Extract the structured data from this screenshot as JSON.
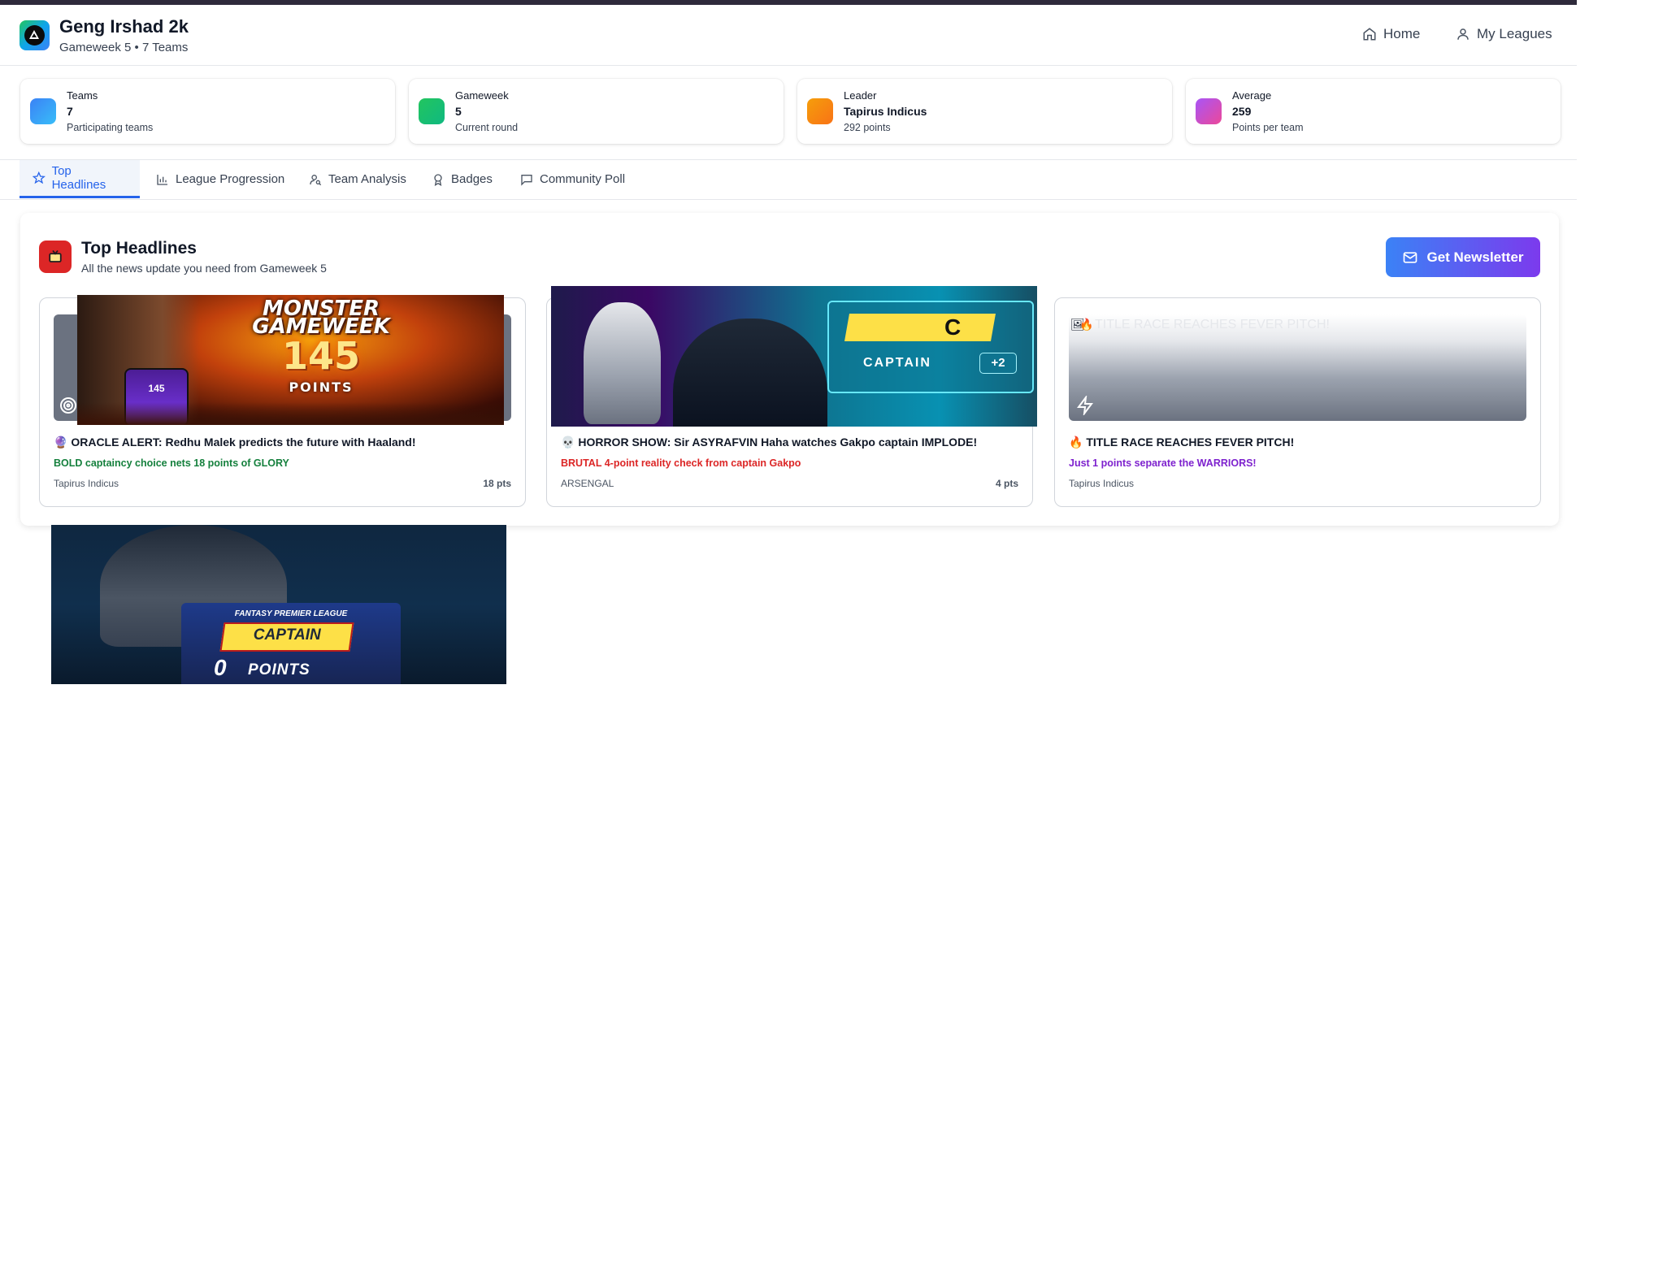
{
  "header": {
    "title": "Geng Irshad 2k",
    "subtitle": "Gameweek 5 • 7 Teams",
    "nav": {
      "home": "Home",
      "my_leagues": "My Leagues"
    }
  },
  "stats": [
    {
      "label": "Teams",
      "value": "7",
      "caption": "Participating teams",
      "color": "#3b82f6"
    },
    {
      "label": "Gameweek",
      "value": "5",
      "caption": "Current round",
      "color": "#22c55e"
    },
    {
      "label": "Leader",
      "value": "Tapirus Indicus",
      "caption": "292 points",
      "color": "#f59e0b"
    },
    {
      "label": "Average",
      "value": "259",
      "caption": "Points per team",
      "color": "#c026d3"
    }
  ],
  "tabs": [
    {
      "label": "Top Headlines",
      "icon": "star-icon",
      "active": true
    },
    {
      "label": "League Progression",
      "icon": "bar-chart-icon"
    },
    {
      "label": "Team Analysis",
      "icon": "user-analysis-icon"
    },
    {
      "label": "Badges",
      "icon": "award-icon"
    },
    {
      "label": "Community Poll",
      "icon": "message-square-icon"
    }
  ],
  "panel": {
    "title": "Top Headlines",
    "subtitle": "All the news update you need from Gameweek 5",
    "newsletter_label": "Get Newsletter"
  },
  "cards": [
    {
      "emoji": "🔮",
      "headline": "ORACLE ALERT: Redhu Malek predicts the future with Haaland!",
      "sub": "BOLD captaincy choice nets 18 points of GLORY",
      "sub_color": "#15803d",
      "author": "Tapirus Indicus",
      "points": "18 pts",
      "image_text_1": "MONSTER",
      "image_text_2": "GAMEWEEK",
      "image_number": "145",
      "image_caption": "POINTS"
    },
    {
      "emoji": "💀",
      "headline": "HORROR SHOW: Sir ASYRAFVIN Haha watches Gakpo captain IMPLODE!",
      "sub": "BRUTAL 4-point reality check from captain Gakpo",
      "sub_color": "#dc2626",
      "author": "ARSENGAL",
      "points": "4 pts",
      "image_badge": "C",
      "image_label": "CAPTAIN",
      "image_plus": "+2"
    },
    {
      "emoji": "🔥",
      "headline": "TITLE RACE REACHES FEVER PITCH!",
      "sub": "Just 1 points separate the WARRIORS!",
      "sub_color": "#7e22ce",
      "author": "Tapirus Indicus",
      "points": "",
      "broken_alt": "TITLE RACE REACHES FEVER PITCH!"
    }
  ],
  "floating_image": {
    "league": "FANTASY PREMIER LEAGUE",
    "word": "CAPTAIN",
    "number": "0",
    "caption": "POINTS"
  }
}
